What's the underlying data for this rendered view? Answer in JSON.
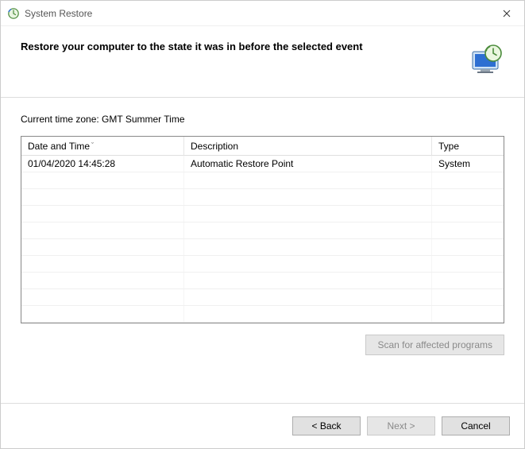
{
  "window": {
    "title": "System Restore"
  },
  "header": {
    "heading": "Restore your computer to the state it was in before the selected event"
  },
  "content": {
    "timezone_label": "Current time zone: GMT Summer Time",
    "columns": {
      "date_time": "Date and Time",
      "description": "Description",
      "type": "Type"
    },
    "rows": [
      {
        "date_time": "01/04/2020 14:45:28",
        "description": "Automatic Restore Point",
        "type": "System"
      }
    ],
    "blank_row_count": 9,
    "scan_button": "Scan for affected programs"
  },
  "footer": {
    "back": "< Back",
    "next": "Next >",
    "cancel": "Cancel"
  }
}
